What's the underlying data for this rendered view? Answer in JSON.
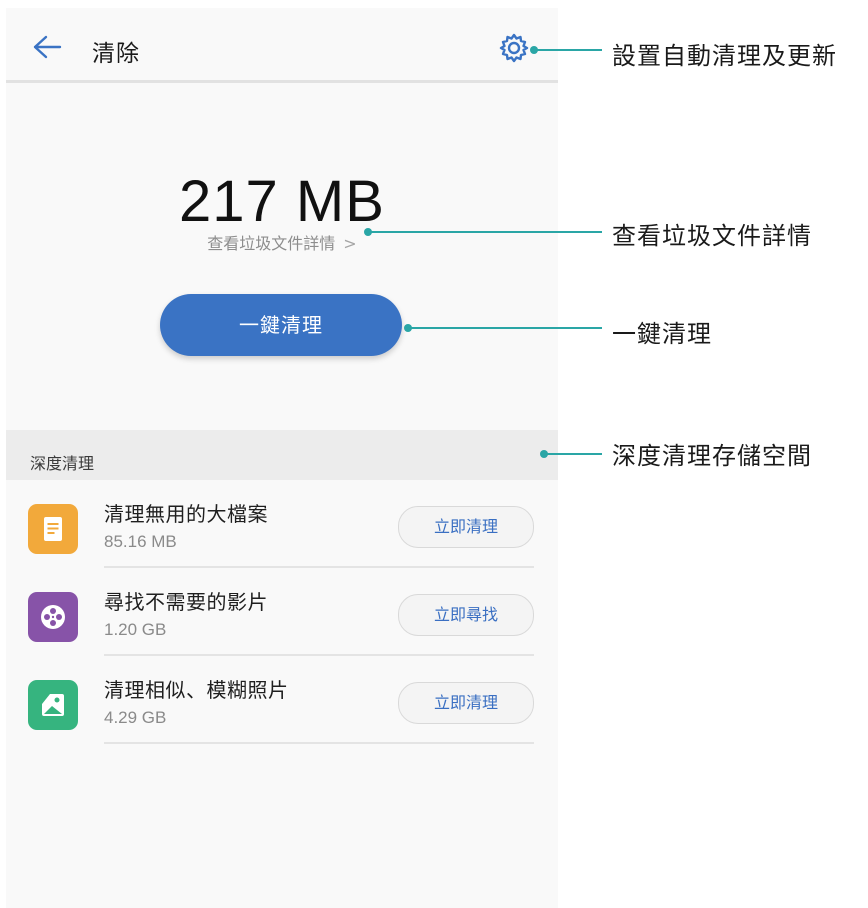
{
  "header": {
    "title": "清除"
  },
  "summary": {
    "size": "217 MB",
    "details_link": "查看垃圾文件詳情",
    "chevron": ">"
  },
  "primary_action": {
    "label": "一鍵清理"
  },
  "deep_clean": {
    "section_title": "深度清理",
    "items": [
      {
        "name": "清理無用的大檔案",
        "size": "85.16 MB",
        "action": "立即清理",
        "icon": "file-document-icon",
        "color": "#f2a93b"
      },
      {
        "name": "尋找不需要的影片",
        "size": "1.20 GB",
        "action": "立即尋找",
        "icon": "film-reel-icon",
        "color": "#8753a8"
      },
      {
        "name": "清理相似、模糊照片",
        "size": "4.29 GB",
        "action": "立即清理",
        "icon": "photo-icon",
        "color": "#36b47f"
      }
    ]
  },
  "annotations": [
    {
      "text": "設置自動清理及更新"
    },
    {
      "text": "查看垃圾文件詳情"
    },
    {
      "text": "一鍵清理"
    },
    {
      "text": "深度清理存儲空間"
    }
  ],
  "colors": {
    "accent": "#3a73c4",
    "callout": "#2aa6a6"
  }
}
